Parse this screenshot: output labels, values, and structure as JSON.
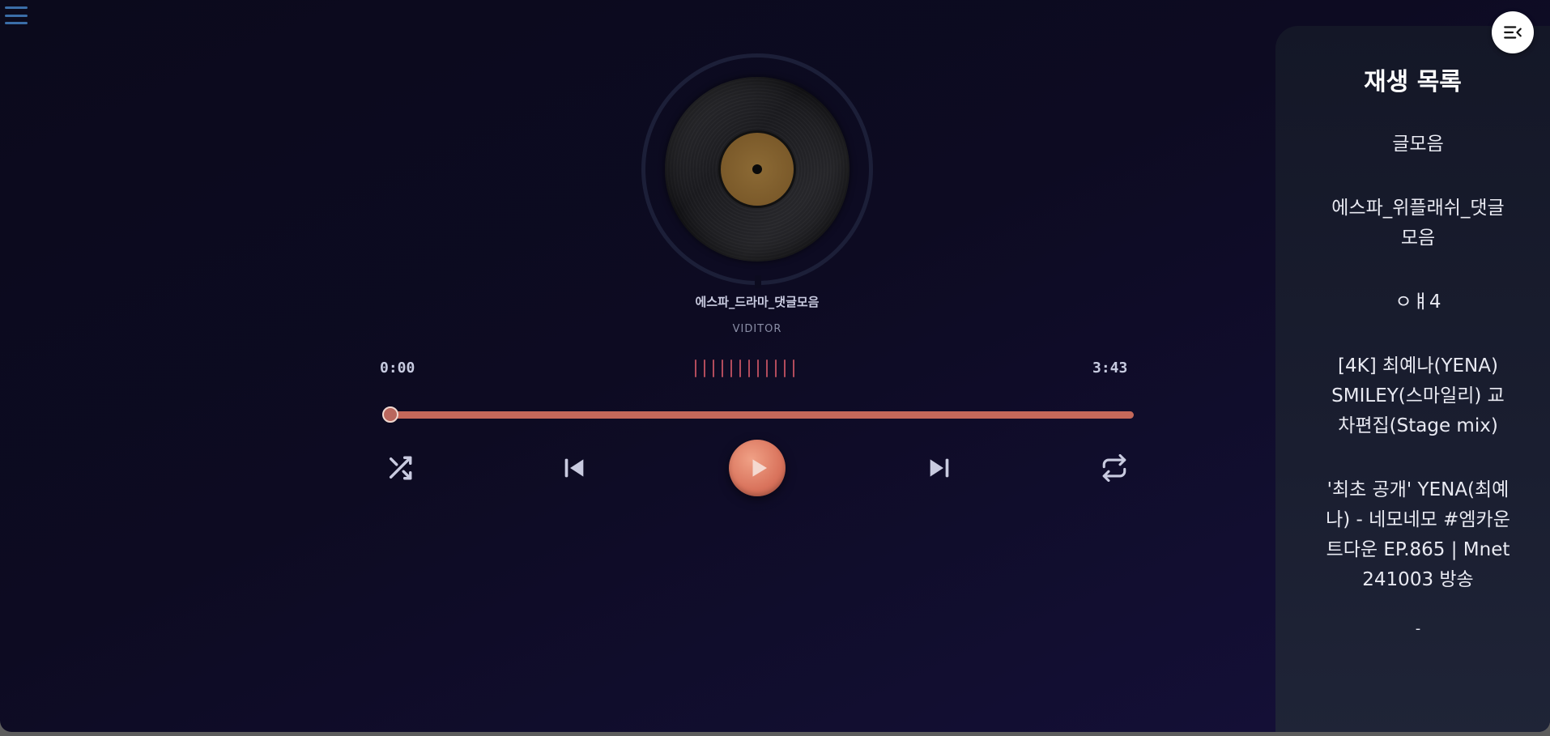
{
  "player": {
    "song_title": "에스파_드라마_댓글모음",
    "artist": "VIDITOR",
    "current_time": "0:00",
    "total_time": "3:43",
    "progress": 0.0
  },
  "playlist": {
    "title": "재생 목록",
    "items": [
      "글모음",
      "에스파_위플래쉬_댓글모음",
      "ㅇㅒ4",
      "[4K] 최예나(YENA) SMILEY(스마일리) 교차편집(Stage mix)",
      "'최초 공개' YENA(최예나) - 네모네모 #엠카운트다운 EP.865 | Mnet 241003 방송",
      "-"
    ]
  },
  "icons": {
    "menu": "hamburger-menu-icon",
    "shuffle": "shuffle-icon",
    "prev": "skip-previous-icon",
    "play": "play-icon",
    "next": "skip-next-icon",
    "repeat": "repeat-icon",
    "playlist_toggle": "playlist-collapse-icon"
  },
  "colors": {
    "accent": "#d9735c",
    "progress": "#c4685a",
    "equalizer": "#b24b5c",
    "text_light": "#c9cbe0"
  }
}
